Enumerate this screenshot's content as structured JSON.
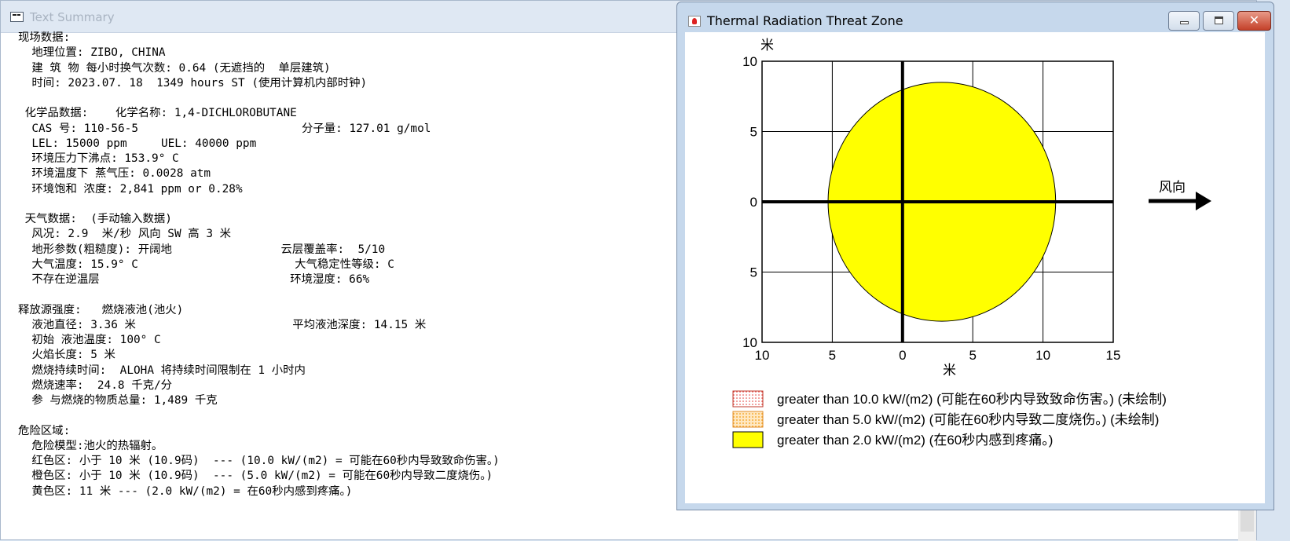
{
  "summary_window": {
    "title": "Text Summary",
    "text": "现场数据:\n  地理位置: ZIBO, CHINA\n  建 筑 物 每小时换气次数: 0.64 (无遮挡的  单层建筑)\n  时间: 2023.07. 18  1349 hours ST (使用计算机内部时钟)\n\n 化学品数据:    化学名称: 1,4-DICHLOROBUTANE\n  CAS 号: 110-56-5                        分子量: 127.01 g/mol\n  LEL: 15000 ppm     UEL: 40000 ppm\n  环境压力下沸点: 153.9° C\n  环境温度下 蒸气压: 0.0028 atm\n  环境饱和 浓度: 2,841 ppm or 0.28%\n\n 天气数据:  (手动输入数据)\n  风况: 2.9  米/秒 风向 SW 高 3 米\n  地形参数(粗糙度): 开阔地                云层覆盖率:  5/10\n  大气温度: 15.9° C                       大气稳定性等级: C\n  不存在逆温层                            环境湿度: 66%\n\n释放源强度:   燃烧液池(池火)\n  液池直径: 3.36 米                       平均液池深度: 14.15 米\n  初始 液池温度: 100° C\n  火焰长度: 5 米\n  燃烧持续时间:  ALOHA 将持续时间限制在 1 小时内\n  燃烧速率:  24.8 千克/分\n  参 与燃烧的物质总量: 1,489 千克\n\n危险区域:\n  危险模型:池火的热辐射。\n  红色区: 小于 10 米 (10.9码)  --- (10.0 kW/(m2) = 可能在60秒内导致致命伤害。)\n  橙色区: 小于 10 米 (10.9码)  --- (5.0 kW/(m2) = 可能在60秒内导致二度烧伤。)\n  黄色区: 11 米 --- (2.0 kW/(m2) = 在60秒内感到疼痛。)"
  },
  "threat_window": {
    "title": "Thermal Radiation Threat Zone",
    "minimize_symbol": "",
    "maximize_symbol": "",
    "close_symbol": "✕",
    "y_unit": "米",
    "x_unit": "米",
    "wind_label": "风向",
    "legend": [
      {
        "label": "greater than 10.0 kW/(m2) (可能在60秒内导致致命伤害。) (未绘制)",
        "style": "dotted-red"
      },
      {
        "label": "greater than 5.0 kW/(m2) (可能在60秒内导致二度烧伤。) (未绘制)",
        "style": "dotted-orange"
      },
      {
        "label": "greater than 2.0 kW/(m2) (在60秒内感到疼痛。)",
        "style": "solid-yellow"
      }
    ]
  },
  "chart_data": {
    "type": "scatter",
    "title": "",
    "xlabel": "米",
    "ylabel": "米",
    "xlim": [
      -10,
      15
    ],
    "ylim": [
      -10,
      10
    ],
    "x_ticks": [
      -10,
      -5,
      0,
      5,
      10,
      15
    ],
    "x_tick_labels": [
      "10",
      "5",
      "0",
      "5",
      "10",
      "15"
    ],
    "y_ticks": [
      10,
      5,
      0,
      -5,
      -10
    ],
    "y_tick_labels": [
      "10",
      "5",
      "0",
      "5",
      "10"
    ],
    "grid": true,
    "zones": [
      {
        "name": "greater than 2.0 kW/(m2)",
        "color": "#ffff00",
        "center": [
          2.8,
          0
        ],
        "x_extent": [
          -5.2,
          11.0
        ],
        "y_extent": [
          -8.5,
          8.5
        ]
      }
    ],
    "wind_direction": "right"
  }
}
